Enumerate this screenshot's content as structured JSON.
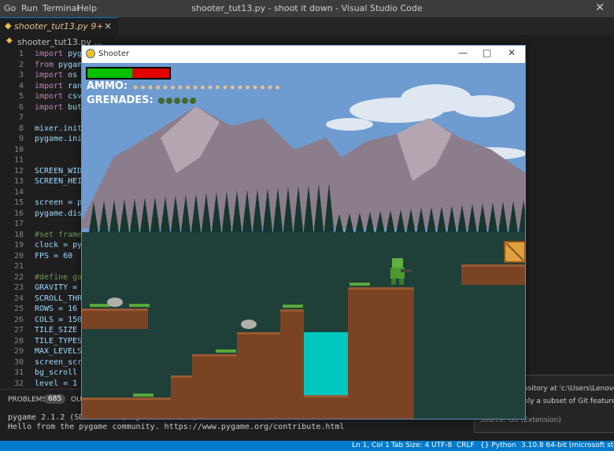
{
  "menubar": {
    "items": [
      "Go",
      "Run",
      "Terminal",
      "Help"
    ],
    "window_title": "shooter_tut13.py - shoot it down - Visual Studio Code",
    "close_glyph": "✕"
  },
  "tab": {
    "label": "shooter_tut13.py 9+",
    "close_glyph": "×"
  },
  "breadcrumb": {
    "file": "shooter_tut13.py",
    "more": "..."
  },
  "code_lines": [
    {
      "n": "1",
      "text": "import pyg"
    },
    {
      "n": "2",
      "text": "from pygame"
    },
    {
      "n": "3",
      "text": "import os"
    },
    {
      "n": "4",
      "text": "import rand"
    },
    {
      "n": "5",
      "text": "import csv"
    },
    {
      "n": "6",
      "text": "import butt"
    },
    {
      "n": "7",
      "text": ""
    },
    {
      "n": "8",
      "text": "mixer.init("
    },
    {
      "n": "9",
      "text": "pygame.init"
    },
    {
      "n": "10",
      "text": ""
    },
    {
      "n": "11",
      "text": ""
    },
    {
      "n": "12",
      "text": "SCREEN_WIDT"
    },
    {
      "n": "13",
      "text": "SCREEN_HEIG"
    },
    {
      "n": "14",
      "text": ""
    },
    {
      "n": "15",
      "text": "screen = py"
    },
    {
      "n": "16",
      "text": "pygame.disp"
    },
    {
      "n": "17",
      "text": ""
    },
    {
      "n": "18",
      "text": "#set framer"
    },
    {
      "n": "19",
      "text": "clock = pyg"
    },
    {
      "n": "20",
      "text": "FPS = 60"
    },
    {
      "n": "21",
      "text": ""
    },
    {
      "n": "22",
      "text": "#define gam"
    },
    {
      "n": "23",
      "text": "GRAVITY = 0"
    },
    {
      "n": "24",
      "text": "SCROLL_THRE"
    },
    {
      "n": "25",
      "text": "ROWS = 16"
    },
    {
      "n": "26",
      "text": "COLS = 150"
    },
    {
      "n": "27",
      "text": "TILE_SIZE ="
    },
    {
      "n": "28",
      "text": "TILE_TYPES"
    },
    {
      "n": "29",
      "text": "MAX_LEVELS"
    },
    {
      "n": "30",
      "text": "screen_scro"
    },
    {
      "n": "31",
      "text": "bg_scroll ="
    },
    {
      "n": "32",
      "text": "level = 1"
    }
  ],
  "panel": {
    "problems_label": "PROBLEMS",
    "problems_count": "685",
    "output_label": "OU",
    "terminal_lines": [
      "pygame 2.1.2 (SDL 2.0.18, Python 3.10.7)",
      "Hello from the pygame community. https://www.pygame.org/contribute.html"
    ]
  },
  "toast": {
    "line1": "ository at 'c:\\Users\\Lenovo'",
    "line2": "nly a subset of Git features v",
    "source": "Source: Git (Extension)"
  },
  "statusbar": {
    "position": "Ln 1, Col 1",
    "tab_size": "Tab Size: 4",
    "encoding": "UTF-8",
    "eol": "CRLF",
    "language": "Python",
    "interpreter": "3.10.8 64-bit (microsoft store)"
  },
  "game_window": {
    "title": "Shooter",
    "minimize_glyph": "—",
    "maximize_glyph": "□",
    "close_glyph": "✕"
  },
  "game": {
    "health_fraction": 0.55,
    "ammo_label": "AMMO:",
    "ammo_count": 20,
    "grenades_label": "GRENADES:",
    "grenades_count": 5,
    "colors": {
      "sky": "#6e9bd0",
      "health_green": "#00c000",
      "health_red": "#e00000",
      "water": "#00c8c0",
      "dirt": "#7a4424",
      "grass": "#5aa83a",
      "tree_dark": "#16362e",
      "mountain": "#8a7a88"
    }
  }
}
